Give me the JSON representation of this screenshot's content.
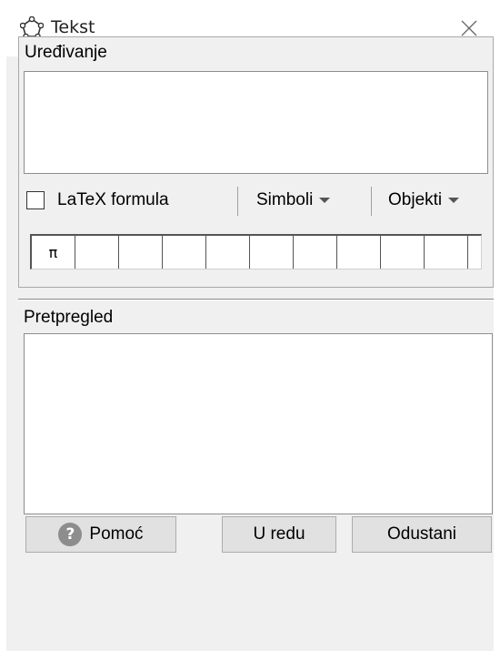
{
  "window": {
    "title": "Tekst"
  },
  "edit": {
    "section_title": "Uređivanje",
    "latex_label": "LaTeX formula",
    "latex_checked": false,
    "symbols_label": "Simboli",
    "objects_label": "Objekti",
    "symbol_cells": [
      "π",
      "",
      "",
      "",
      "",
      "",
      "",
      "",
      "",
      "",
      ""
    ]
  },
  "preview": {
    "section_title": "Pretpregled"
  },
  "buttons": {
    "help": "Pomoć",
    "ok": "U redu",
    "cancel": "Odustani"
  },
  "icons": {
    "app": "pentagon-star-icon",
    "close": "close-icon",
    "help": "question-icon"
  }
}
